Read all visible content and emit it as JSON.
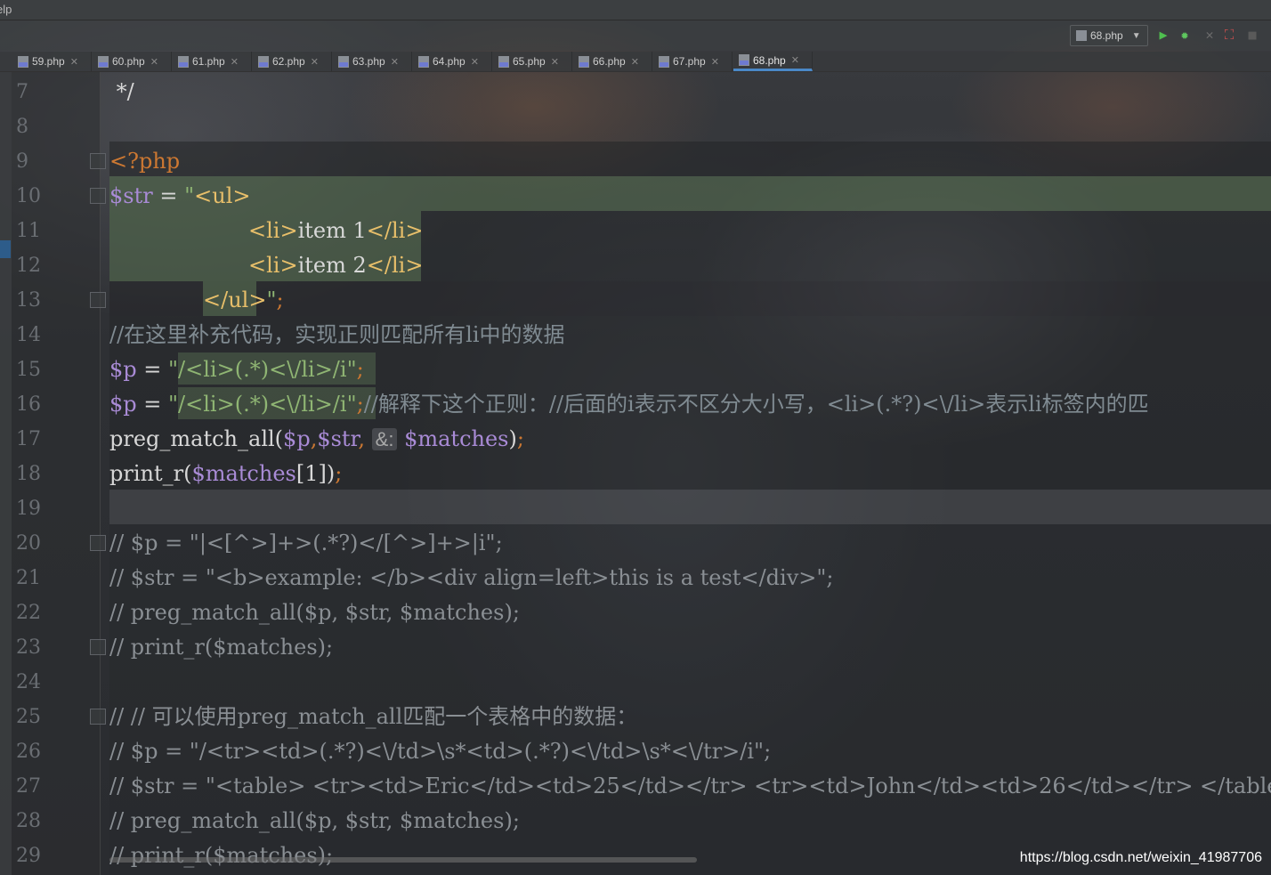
{
  "menubar": {
    "text": "elp"
  },
  "run_config": {
    "label": "68.php"
  },
  "tabs": [
    "59.php",
    "60.php",
    "61.php",
    "62.php",
    "63.php",
    "64.php",
    "65.php",
    "66.php",
    "67.php",
    "68.php"
  ],
  "active_tab": "68.php",
  "line_numbers": [
    "7",
    "8",
    "9",
    "10",
    "11",
    "12",
    "13",
    "14",
    "15",
    "16",
    "17",
    "18",
    "19",
    "20",
    "21",
    "22",
    "23",
    "24",
    "25",
    "26",
    "27",
    "28",
    "29"
  ],
  "code": {
    "l7": " */",
    "l9_kw": "<?php",
    "l10_var": "$str",
    "l10_eq": " = ",
    "l10_q": "\"",
    "l10_tag": "<ul>",
    "l11_tag1": "<li>",
    "l11_text": "item 1",
    "l11_tag2": "</li>",
    "l12_tag1": "<li>",
    "l12_text": "item 2",
    "l12_tag2": "</li>",
    "l13_tag": "</ul>",
    "l13_q": "\"",
    "l13_semi": ";",
    "l14_cmt": "//在这里补充代码，实现正则匹配所有li中的数据",
    "l15_var": "$p",
    "l15_eq": " = ",
    "l15_str": "\"/<li>(.*)<\\/li>/i\"",
    "l15_semi": ";",
    "l16_var": "$p",
    "l16_eq": " = ",
    "l16_str": "\"/<li>(.*)<\\/li>/i\"",
    "l16_semi": ";",
    "l16_cmt": "//解释下这个正则：//后面的i表示不区分大小写，<li>(.*?)<\\/li>表示li标签内的匹",
    "l17_fn": "preg_match_all(",
    "l17_v1": "$p",
    "l17_c1": ",",
    "l17_v2": "$str",
    "l17_c2": ", ",
    "l17_hint": "&:",
    "l17_v3": " $matches",
    "l17_end": ")",
    "l17_semi": ";",
    "l18_fn": "print_r(",
    "l18_var": "$matches",
    "l18_idx": "[1])",
    "l18_semi": ";",
    "l20": "// $p = \"|<[^>]+>(.*?)</[^>]+>|i\";",
    "l21": "// $str = \"<b>example: </b><div align=left>this is a test</div>\";",
    "l22": "// preg_match_all($p, $str, $matches);",
    "l23": "// print_r($matches);",
    "l25": "// // 可以使用preg_match_all匹配一个表格中的数据：",
    "l26": "// $p = \"/<tr><td>(.*?)<\\/td>\\s*<td>(.*?)<\\/td>\\s*<\\/tr>/i\";",
    "l27": "// $str = \"<table> <tr><td>Eric</td><td>25</td></tr> <tr><td>John</td><td>26</td></tr> </table>\";",
    "l28": "// preg_match_all($p, $str, $matches);",
    "l29": "// print_r($matches);"
  },
  "watermark": "https://blog.csdn.net/weixin_41987706",
  "colors": {
    "keyword": "#cc7832",
    "variable": "#a98bd6",
    "string": "#8fb573",
    "tag": "#e8bf6a",
    "comment": "#808b92",
    "tab_active": "#4a88c7"
  }
}
